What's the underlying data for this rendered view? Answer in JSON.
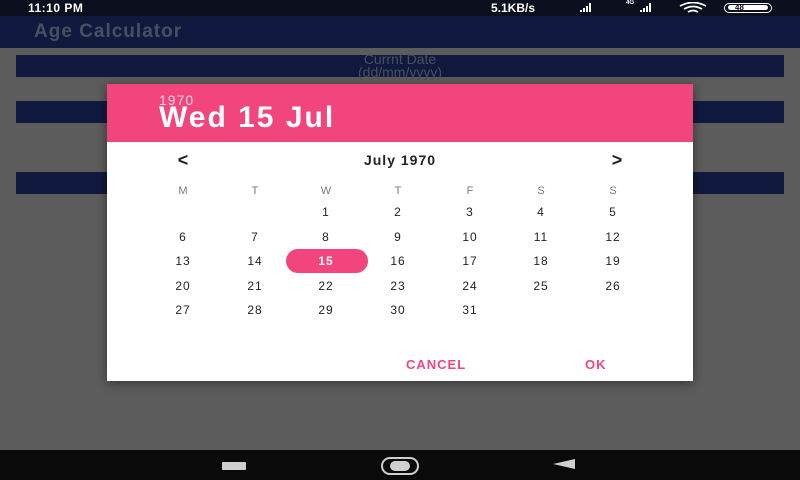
{
  "status_bar": {
    "time": "11:10 PM",
    "speed": "5.1KB/s",
    "network_label": "4G",
    "battery_level": "48"
  },
  "app": {
    "title": "Age Calculator",
    "current_date_label": "Currnt Date",
    "date_format_label": "(dd/mm/yyyy)"
  },
  "dialog": {
    "year": "1970",
    "selected_date": "Wed 15 Jul",
    "month_title": "July 1970",
    "prev_arrow": "<",
    "next_arrow": ">",
    "weekdays": [
      "M",
      "T",
      "W",
      "T",
      "F",
      "S",
      "S"
    ],
    "weeks": [
      [
        "",
        "",
        "1",
        "2",
        "3",
        "4",
        "5"
      ],
      [
        "6",
        "7",
        "8",
        "9",
        "10",
        "11",
        "12"
      ],
      [
        "13",
        "14",
        "15",
        "16",
        "17",
        "18",
        "19"
      ],
      [
        "20",
        "21",
        "22",
        "23",
        "24",
        "25",
        "26"
      ],
      [
        "27",
        "28",
        "29",
        "30",
        "31",
        "",
        ""
      ]
    ],
    "selected_day": "15",
    "cancel_label": "CANCEL",
    "ok_label": "OK"
  },
  "colors": {
    "accent": "#f2457e",
    "primary_dark": "#111a3e",
    "status_bar": "#0c0f1d"
  }
}
